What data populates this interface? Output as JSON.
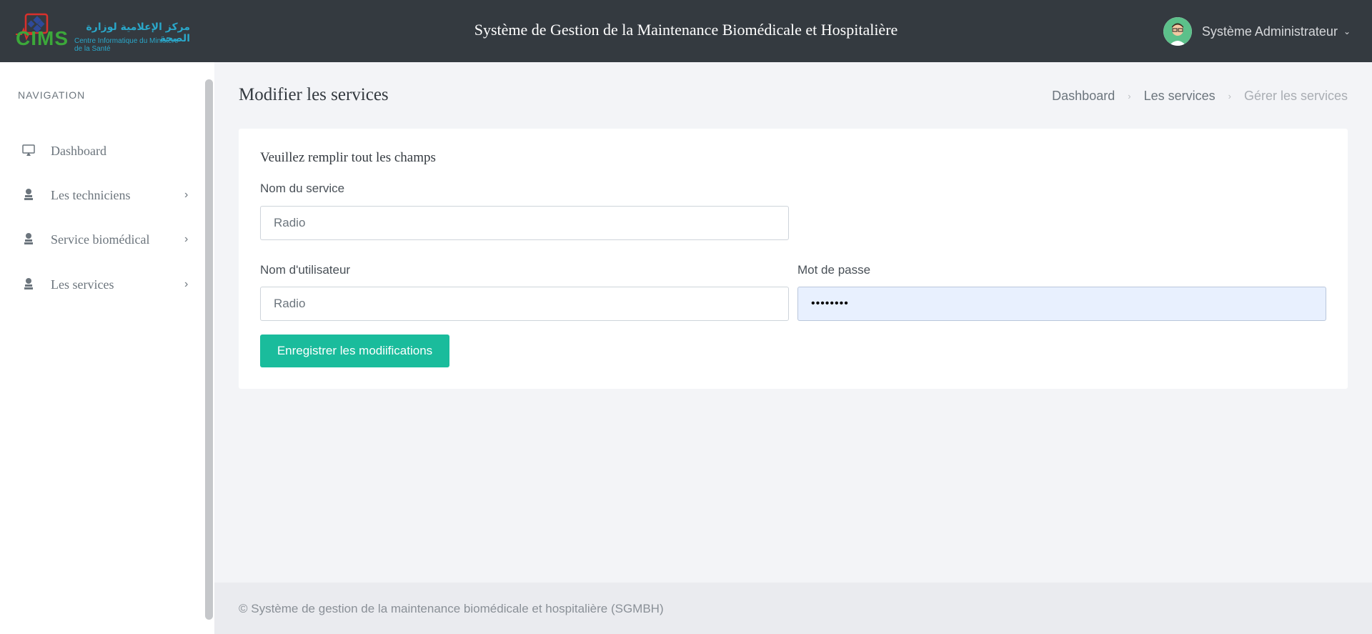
{
  "header": {
    "logo_arabic": "مركز الإعلامية لوزارة الصحة",
    "logo_french": "Centre Informatique du Ministère de la Santé",
    "logo_acronym": "CIMS",
    "app_title": "Système de Gestion de la Maintenance Biomédicale et Hospitalière",
    "user_name": "Système Administrateur",
    "user_menu_icon": "chevron-down-icon"
  },
  "sidebar": {
    "section_title": "NAVIGATION",
    "items": [
      {
        "label": "Dashboard",
        "icon": "monitor-icon",
        "has_submenu": false
      },
      {
        "label": "Les techniciens",
        "icon": "user-icon",
        "has_submenu": true
      },
      {
        "label": "Service biomédical",
        "icon": "user-icon",
        "has_submenu": true
      },
      {
        "label": "Les services",
        "icon": "user-icon",
        "has_submenu": true
      }
    ]
  },
  "main": {
    "page_title": "Modifier les services",
    "breadcrumb": [
      "Dashboard",
      "Les services",
      "Gérer les services"
    ],
    "form": {
      "intro": "Veuillez remplir tout les champs",
      "service_name_label": "Nom du service",
      "service_name_value": "Radio",
      "username_label": "Nom d'utilisateur",
      "username_value": "Radio",
      "password_label": "Mot de passe",
      "password_value": "••••••••",
      "submit_label": "Enregistrer les modiifications"
    }
  },
  "footer": {
    "text": "© Système de gestion de la maintenance biomédicale et hospitalière (SGMBH)"
  },
  "colors": {
    "header_bg": "#343a40",
    "accent": "#1abc9c",
    "autofill_bg": "#e8f0fe"
  }
}
